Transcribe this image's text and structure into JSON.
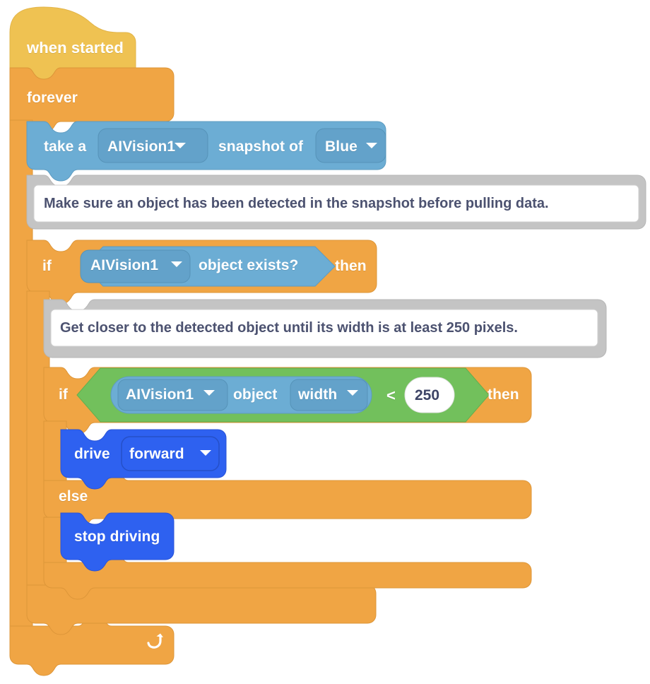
{
  "program": {
    "title": "VEX AI Vision block program",
    "blocks": [
      {
        "id": "when-started",
        "type": "hat",
        "label": "when started",
        "color": "#EFC252"
      },
      {
        "id": "forever",
        "type": "c-loop",
        "label": "forever",
        "color": "#F0A544",
        "loop_icon": "loop-arrow-icon"
      },
      {
        "id": "take-snapshot",
        "type": "sensing-stack",
        "color": "#6CADD4",
        "text_1": "take a",
        "dropdown_1": {
          "value": "AIVision1",
          "icon": "chevron-down-icon"
        },
        "text_2": "snapshot of",
        "dropdown_2": {
          "value": "Blue",
          "icon": "chevron-down-icon"
        }
      },
      {
        "id": "comment-1",
        "type": "comment",
        "color": "#C4C4C4",
        "text": "Make sure an object has been detected in the snapshot before pulling data."
      },
      {
        "id": "if-object-exists",
        "type": "c-if",
        "color": "#F0A544",
        "keyword_if": "if",
        "keyword_then": "then",
        "condition": {
          "type": "sensing-boolean",
          "color": "#6CADD4",
          "dropdown": {
            "value": "AIVision1",
            "icon": "chevron-down-icon"
          },
          "text": "object exists?"
        }
      },
      {
        "id": "comment-2",
        "type": "comment",
        "color": "#C4C4C4",
        "text": "Get closer to the detected object until its width is at least 250 pixels."
      },
      {
        "id": "if-width-less-than",
        "type": "c-if-else",
        "color": "#F0A544",
        "keyword_if": "if",
        "keyword_then": "then",
        "keyword_else": "else",
        "condition": {
          "type": "operator-less-than",
          "color": "#72C05C",
          "operator": "<",
          "left": {
            "type": "sensing-reporter",
            "color": "#6CADD4",
            "dropdown_1": {
              "value": "AIVision1",
              "icon": "chevron-down-icon"
            },
            "text": "object",
            "dropdown_2": {
              "value": "width",
              "icon": "chevron-down-icon"
            }
          },
          "right": {
            "type": "number-input",
            "value": "250"
          }
        }
      },
      {
        "id": "drive-forward",
        "type": "motor-stack",
        "color": "#2E61F0",
        "text": "drive",
        "dropdown": {
          "value": "forward",
          "icon": "chevron-down-icon"
        }
      },
      {
        "id": "stop-driving",
        "type": "motor-stack",
        "color": "#2E61F0",
        "text": "stop driving"
      }
    ]
  },
  "colors": {
    "hat_yellow": "#EFC252",
    "control_orange": "#F0A544",
    "sensing_blue": "#6CADD4",
    "operator_green": "#72C05C",
    "motor_blue": "#2E61F0",
    "comment_gray": "#C4C4C4",
    "comment_body": "#FFFFFF",
    "comment_text": "#4C5270",
    "canvas": "#FFFFFF"
  }
}
